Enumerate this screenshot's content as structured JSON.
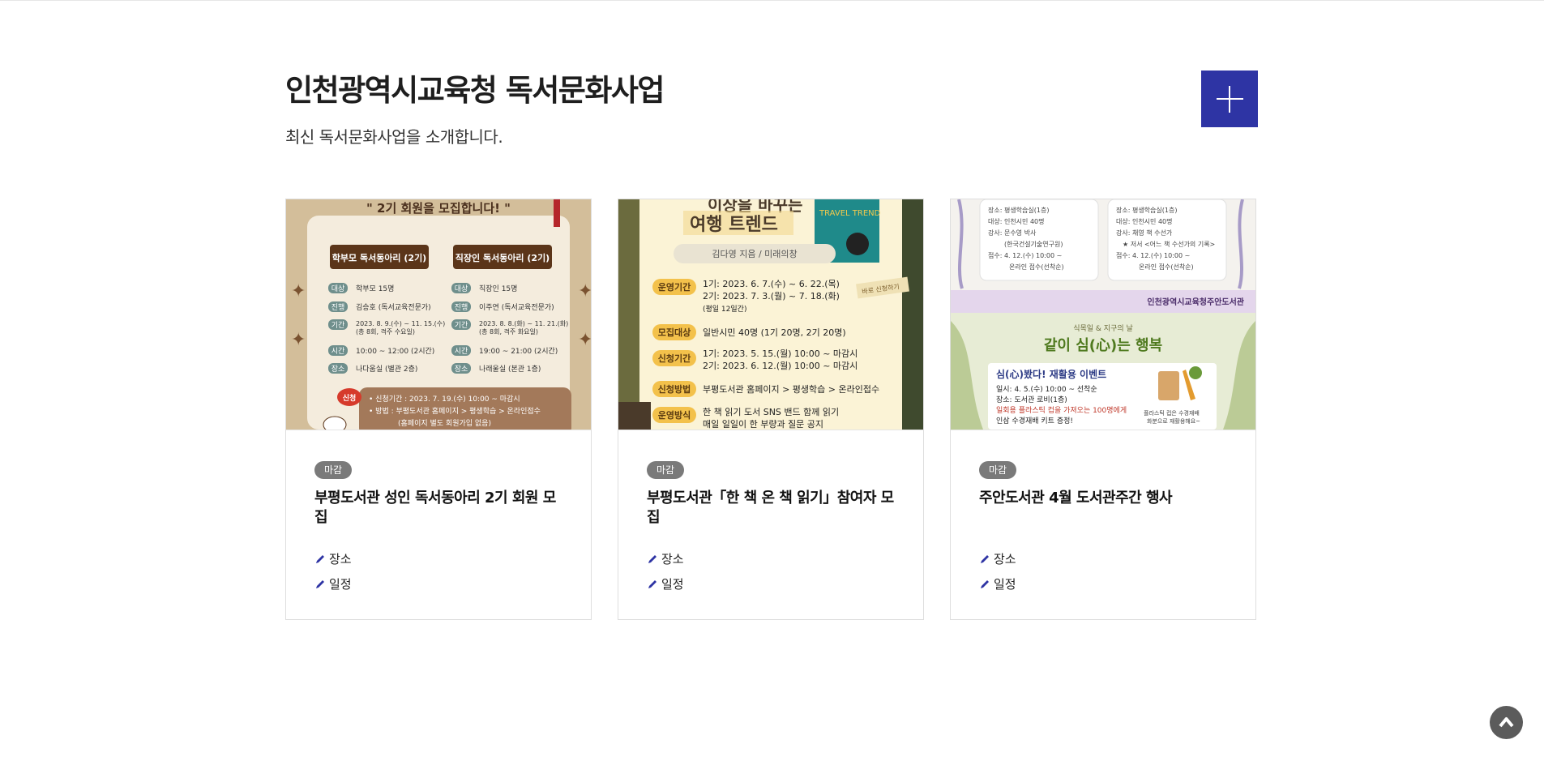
{
  "section": {
    "title": "인천광역시교육청 독서문화사업",
    "subtitle": "최신 독서문화사업을 소개합니다.",
    "more_button_icon": "plus-icon"
  },
  "colors": {
    "accent": "#2e34a4",
    "badge": "#7a7a7a",
    "pen_icon": "#2e34a4"
  },
  "cards": [
    {
      "status": "마감",
      "title": "부평도서관 성인 독서동아리 2기 회원 모집",
      "place_label": "장소",
      "schedule_label": "일정",
      "poster": {
        "headline": "\" 2기 회원을 모집합니다! \"",
        "group_a": "학부모 독서동아리 (2기)",
        "group_b": "직장인 독서동아리 (2기)",
        "rows_a": [
          {
            "k": "대상",
            "v": "학부모 15명"
          },
          {
            "k": "진행",
            "v": "김승호 (독서교육전문가)"
          },
          {
            "k": "기간",
            "v": "2023. 8. 9.(수) ~ 11. 15.(수)"
          },
          {
            "k": "시간",
            "v": "10:00 ~ 12:00 (2시간)"
          },
          {
            "k": "장소",
            "v": "나다움실 (별관 2층)"
          }
        ],
        "rows_a_extra": "(총 8회, 격주 수요일)",
        "rows_b": [
          {
            "k": "대상",
            "v": "직장인 15명"
          },
          {
            "k": "진행",
            "v": "이주연 (독서교육전문가)"
          },
          {
            "k": "기간",
            "v": "2023. 8. 8.(화) ~ 11. 21.(화)"
          },
          {
            "k": "시간",
            "v": "19:00 ~ 21:00 (2시간)"
          },
          {
            "k": "장소",
            "v": "나래울실 (본관 1층)"
          }
        ],
        "rows_b_extra": "(총 8회, 격주 화요일)",
        "apply_tag": "신청",
        "apply_lines": [
          "• 신청기간 : 2023. 7. 19.(수) 10:00 ~ 마감시",
          "• 방법 : 부평도서관 홈페이지 > 평생학습 > 온라인접수",
          "(홈페이지 별도 회원가입 없음)"
        ]
      }
    },
    {
      "status": "마감",
      "title": "부평도서관「한 책 온 책 읽기」참여자 모집",
      "place_label": "장소",
      "schedule_label": "일정",
      "poster": {
        "head1": "이상을 바꾸는",
        "head2": "여행 트렌드",
        "author": "김다영 지음 / 미래의창",
        "book_cover_text": "TRAVEL TREND",
        "tag": "바로 신청하기",
        "rows": [
          {
            "k": "운영기간",
            "v": [
              "1기: 2023. 6. 7.(수) ~ 6. 22.(목)",
              "2기: 2023. 7. 3.(월) ~ 7. 18.(화)",
              "(평일 12일간)"
            ]
          },
          {
            "k": "모집대상",
            "v": [
              "일반시민 40명 (1기 20명, 2기 20명)"
            ]
          },
          {
            "k": "신청기간",
            "v": [
              "1기: 2023. 5. 15.(월) 10:00 ~ 마감시",
              "2기: 2023. 6. 12.(월) 10:00 ~ 마감시"
            ]
          },
          {
            "k": "신청방법",
            "v": [
              "부평도서관 홈페이지 > 평생학습 > 온라인접수"
            ]
          },
          {
            "k": "운영방식",
            "v": [
              "한 책 읽기 도서 SNS 밴드 함께 읽기",
              "매일 일일이 한 부량과 질문 공지"
            ]
          }
        ]
      }
    },
    {
      "status": "마감",
      "title": "주안도서관 4월 도서관주간 행사",
      "place_label": "장소",
      "schedule_label": "일정",
      "poster": {
        "note_a": [
          "장소: 평생학습실(1층)",
          "대상: 인천시민 40명",
          "강사: 문수영 박사",
          "(한국건설기술연구원)",
          "접수: 4. 12.(수) 10:00 ~",
          "온라인 접수(선착순)"
        ],
        "note_b": [
          "장소: 평생학습실(1층)",
          "대상: 인천시민 40명",
          "강사: 채영 책 수선가",
          "★ 저서 <어느 책 수선가의 기록>",
          "접수: 4. 12.(수) 10:00 ~",
          "온라인 접수(선착순)"
        ],
        "banner": "인천광역시교육청주안도서관",
        "small_head": "식목일 & 지구의 날",
        "big_head": "같이 심(心)는 행복",
        "event_title": "심(心)봤다! 재활용 이벤트",
        "event_lines": [
          "일시: 4. 5.(수) 10:00 ~ 선착순",
          "장소: 도서관 로비(1층)",
          "일회용 플라스틱 컵을 가져오는 100명에게",
          "인삼 수경재배 키트 증정!"
        ],
        "side_note": [
          "플라스틱 컵은 수경재배",
          "화분으로 재활용해요~"
        ]
      }
    }
  ],
  "scroll_top_icon": "chevron-up-icon"
}
